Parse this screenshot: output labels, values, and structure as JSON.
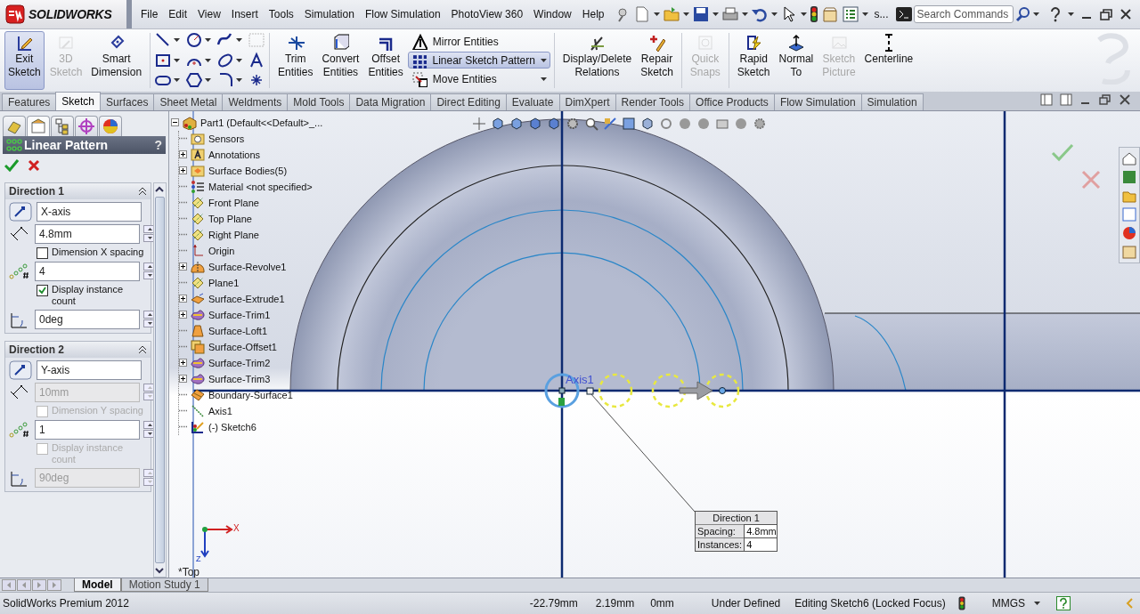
{
  "app": {
    "logo": "SOLIDWORKS"
  },
  "menu": [
    {
      "label": "File"
    },
    {
      "label": "Edit"
    },
    {
      "label": "View"
    },
    {
      "label": "Insert"
    },
    {
      "label": "Tools"
    },
    {
      "label": "Simulation"
    },
    {
      "label": "Flow Simulation"
    },
    {
      "label": "PhotoView 360"
    },
    {
      "label": "Window"
    },
    {
      "label": "Help"
    }
  ],
  "toolbar_overflow": "s...",
  "search": {
    "placeholder": "Search Commands"
  },
  "ribbon": [
    {
      "kind": "large",
      "label": "Exit Sketch",
      "selected": true,
      "disabled": false
    },
    {
      "kind": "large",
      "label": "3D Sketch",
      "selected": false,
      "disabled": true
    },
    {
      "kind": "large",
      "label": "Smart Dimension",
      "selected": false,
      "disabled": false
    },
    {
      "kind": "tool-grid"
    },
    {
      "kind": "large",
      "label": "Trim Entities",
      "selected": false,
      "disabled": false
    },
    {
      "kind": "large",
      "label": "Convert Entities",
      "selected": false,
      "disabled": false
    },
    {
      "kind": "large",
      "label": "Offset Entities",
      "selected": false,
      "disabled": false
    },
    {
      "kind": "stack",
      "items": [
        {
          "label": "Mirror Entities",
          "selected": false
        },
        {
          "label": "Linear Sketch Pattern",
          "selected": true
        },
        {
          "label": "Move Entities",
          "selected": false
        }
      ]
    },
    {
      "kind": "large",
      "label": "Display/Delete Relations",
      "selected": false,
      "disabled": false
    },
    {
      "kind": "large",
      "label": "Repair Sketch",
      "selected": false,
      "disabled": false
    },
    {
      "kind": "large",
      "label": "Quick Snaps",
      "selected": false,
      "disabled": true
    },
    {
      "kind": "large",
      "label": "Rapid Sketch",
      "selected": false,
      "disabled": false
    },
    {
      "kind": "large",
      "label": "Normal To",
      "selected": false,
      "disabled": false
    },
    {
      "kind": "large",
      "label": "Sketch Picture",
      "selected": false,
      "disabled": true
    },
    {
      "kind": "large",
      "label": "Centerline",
      "selected": false,
      "disabled": false
    }
  ],
  "command_tabs": [
    {
      "label": "Features",
      "selected": false
    },
    {
      "label": "Sketch",
      "selected": true
    },
    {
      "label": "Surfaces",
      "selected": false
    },
    {
      "label": "Sheet Metal",
      "selected": false
    },
    {
      "label": "Weldments",
      "selected": false
    },
    {
      "label": "Mold Tools",
      "selected": false
    },
    {
      "label": "Data Migration",
      "selected": false
    },
    {
      "label": "Direct Editing",
      "selected": false
    },
    {
      "label": "Evaluate",
      "selected": false
    },
    {
      "label": "DimXpert",
      "selected": false
    },
    {
      "label": "Render Tools",
      "selected": false
    },
    {
      "label": "Office Products",
      "selected": false
    },
    {
      "label": "Flow Simulation",
      "selected": false
    },
    {
      "label": "Simulation",
      "selected": false
    }
  ],
  "property_manager": {
    "title": "Linear Pattern",
    "help": "?",
    "sections": [
      {
        "title": "Direction 1",
        "rows": [
          {
            "kind": "direction",
            "value": "X-axis",
            "disabled": false
          },
          {
            "kind": "spacing",
            "value": "4.8mm",
            "disabled": false
          },
          {
            "kind": "checkbox",
            "label": "Dimension X spacing",
            "checked": false,
            "disabled": false
          },
          {
            "kind": "count",
            "value": "4",
            "disabled": false
          },
          {
            "kind": "checkbox",
            "label": "Display instance count",
            "checked": true,
            "disabled": false
          },
          {
            "kind": "angle",
            "value": "0deg",
            "disabled": false
          }
        ]
      },
      {
        "title": "Direction 2",
        "rows": [
          {
            "kind": "direction",
            "value": "Y-axis",
            "disabled": false
          },
          {
            "kind": "spacing",
            "value": "10mm",
            "disabled": true
          },
          {
            "kind": "checkbox",
            "label": "Dimension Y spacing",
            "checked": false,
            "disabled": true
          },
          {
            "kind": "count",
            "value": "1",
            "disabled": false
          },
          {
            "kind": "checkbox",
            "label": "Display instance count",
            "checked": false,
            "disabled": true
          },
          {
            "kind": "angle",
            "value": "90deg",
            "disabled": true
          }
        ]
      }
    ]
  },
  "feature_tree": {
    "label": "Part1  (Default<<Default>_...",
    "children": [
      {
        "label": "Sensors",
        "kind": "sensors",
        "has_children": false
      },
      {
        "label": "Annotations",
        "kind": "annotations",
        "has_children": true
      },
      {
        "label": "Surface Bodies(5)",
        "kind": "bodies",
        "has_children": true
      },
      {
        "label": "Material <not specified>",
        "kind": "material",
        "has_children": false
      },
      {
        "label": "Front Plane",
        "kind": "plane",
        "has_children": false
      },
      {
        "label": "Top Plane",
        "kind": "plane",
        "has_children": false
      },
      {
        "label": "Right Plane",
        "kind": "plane",
        "has_children": false
      },
      {
        "label": "Origin",
        "kind": "origin",
        "has_children": false
      },
      {
        "label": "Surface-Revolve1",
        "kind": "revolve",
        "has_children": true
      },
      {
        "label": "Plane1",
        "kind": "plane",
        "has_children": false
      },
      {
        "label": "Surface-Extrude1",
        "kind": "extrude",
        "has_children": true
      },
      {
        "label": "Surface-Trim1",
        "kind": "trim",
        "has_children": true
      },
      {
        "label": "Surface-Loft1",
        "kind": "loft",
        "has_children": false
      },
      {
        "label": "Surface-Offset1",
        "kind": "offset",
        "has_children": false
      },
      {
        "label": "Surface-Trim2",
        "kind": "trim",
        "has_children": true
      },
      {
        "label": "Surface-Trim3",
        "kind": "trim",
        "has_children": true
      },
      {
        "label": "Boundary-Surface1",
        "kind": "boundary",
        "has_children": false
      },
      {
        "label": "Axis1",
        "kind": "axis",
        "has_children": false
      },
      {
        "label": "(-) Sketch6",
        "kind": "sketch",
        "has_children": false
      }
    ]
  },
  "viewport": {
    "view_name": "*Top",
    "axis_label": "Axis1",
    "triad": {
      "x": "X",
      "z": "Z"
    },
    "callout": {
      "title": "Direction 1",
      "rows": [
        {
          "label": "Spacing:",
          "value": "4.8mm"
        },
        {
          "label": "Instances:",
          "value": "4"
        }
      ]
    }
  },
  "bottom_tabs": [
    {
      "label": "Model",
      "selected": true
    },
    {
      "label": "Motion Study 1",
      "selected": false
    }
  ],
  "status_bar": {
    "product": "SolidWorks Premium 2012",
    "x": "-22.79mm",
    "y": "2.19mm",
    "z": "0mm",
    "sketch_state": "Under Defined",
    "mode": "Editing Sketch6 (Locked Focus)",
    "units": "MMGS"
  }
}
